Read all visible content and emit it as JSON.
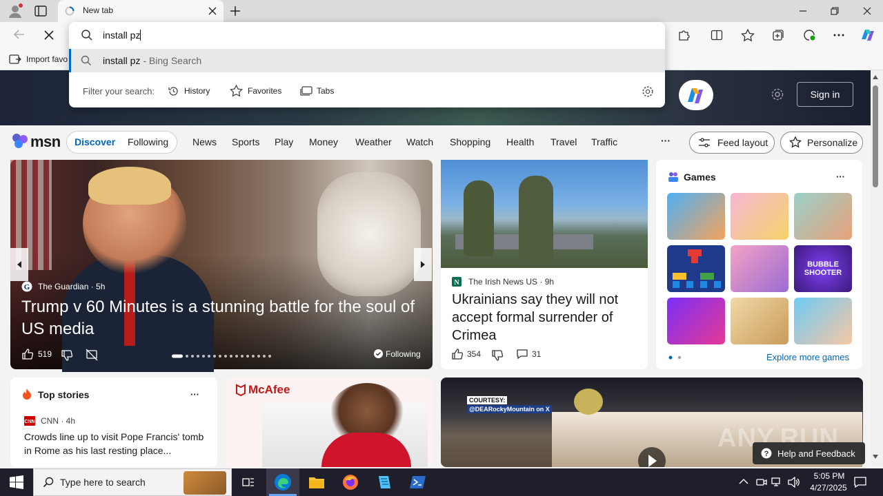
{
  "browser": {
    "tab_title": "New tab",
    "favorites_bar": {
      "import_label": "Import favo"
    }
  },
  "omnibox": {
    "input_value": "install pz",
    "suggestion": {
      "query": "install pz",
      "suffix": " - Bing Search"
    },
    "filter_label": "Filter your search:",
    "filters": [
      "History",
      "Favorites",
      "Tabs"
    ]
  },
  "msn": {
    "logo": "msn",
    "signin_label": "Sign in",
    "segments": {
      "discover": "Discover",
      "following": "Following"
    },
    "nav": [
      "News",
      "Sports",
      "Play",
      "Money",
      "Weather",
      "Watch",
      "Shopping",
      "Health",
      "Travel",
      "Traffic"
    ],
    "more_label": "···",
    "feed_layout_label": "Feed layout",
    "personalize_label": "Personalize",
    "hero": {
      "source": "The Guardian · 5h",
      "headline": "Trump v 60 Minutes is a stunning battle for the soul of US media",
      "likes": "519",
      "following_label": "Following"
    },
    "irish": {
      "source": "The Irish News US · 9h",
      "headline": "Ukrainians say they will not accept formal surrender of Crimea",
      "likes": "354",
      "comments": "31"
    },
    "games": {
      "title": "Games",
      "more_label": "···",
      "explore_label": "Explore more games",
      "bubble_label": "BUBBLE SHOOTER"
    },
    "top_stories": {
      "title": "Top stories",
      "source": "CNN · 4h",
      "headline": "Crowds line up to visit Pope Francis' tomb in Rome as his last resting place..."
    },
    "mcafee": {
      "logo": "McAfee"
    },
    "video": {
      "courtesy": "COURTESY:",
      "courtesy_handle": "@DEARockyMountain on X",
      "watermark": "ANY.RUN"
    },
    "help_feedback": "Help and Feedback"
  },
  "taskbar": {
    "search_placeholder": "Type here to search",
    "time": "5:05 PM",
    "date": "4/27/2025"
  },
  "colors": {
    "accent": "#0067c0",
    "mcafee_red": "#c01818",
    "taskbar": "#1f1f2b"
  }
}
